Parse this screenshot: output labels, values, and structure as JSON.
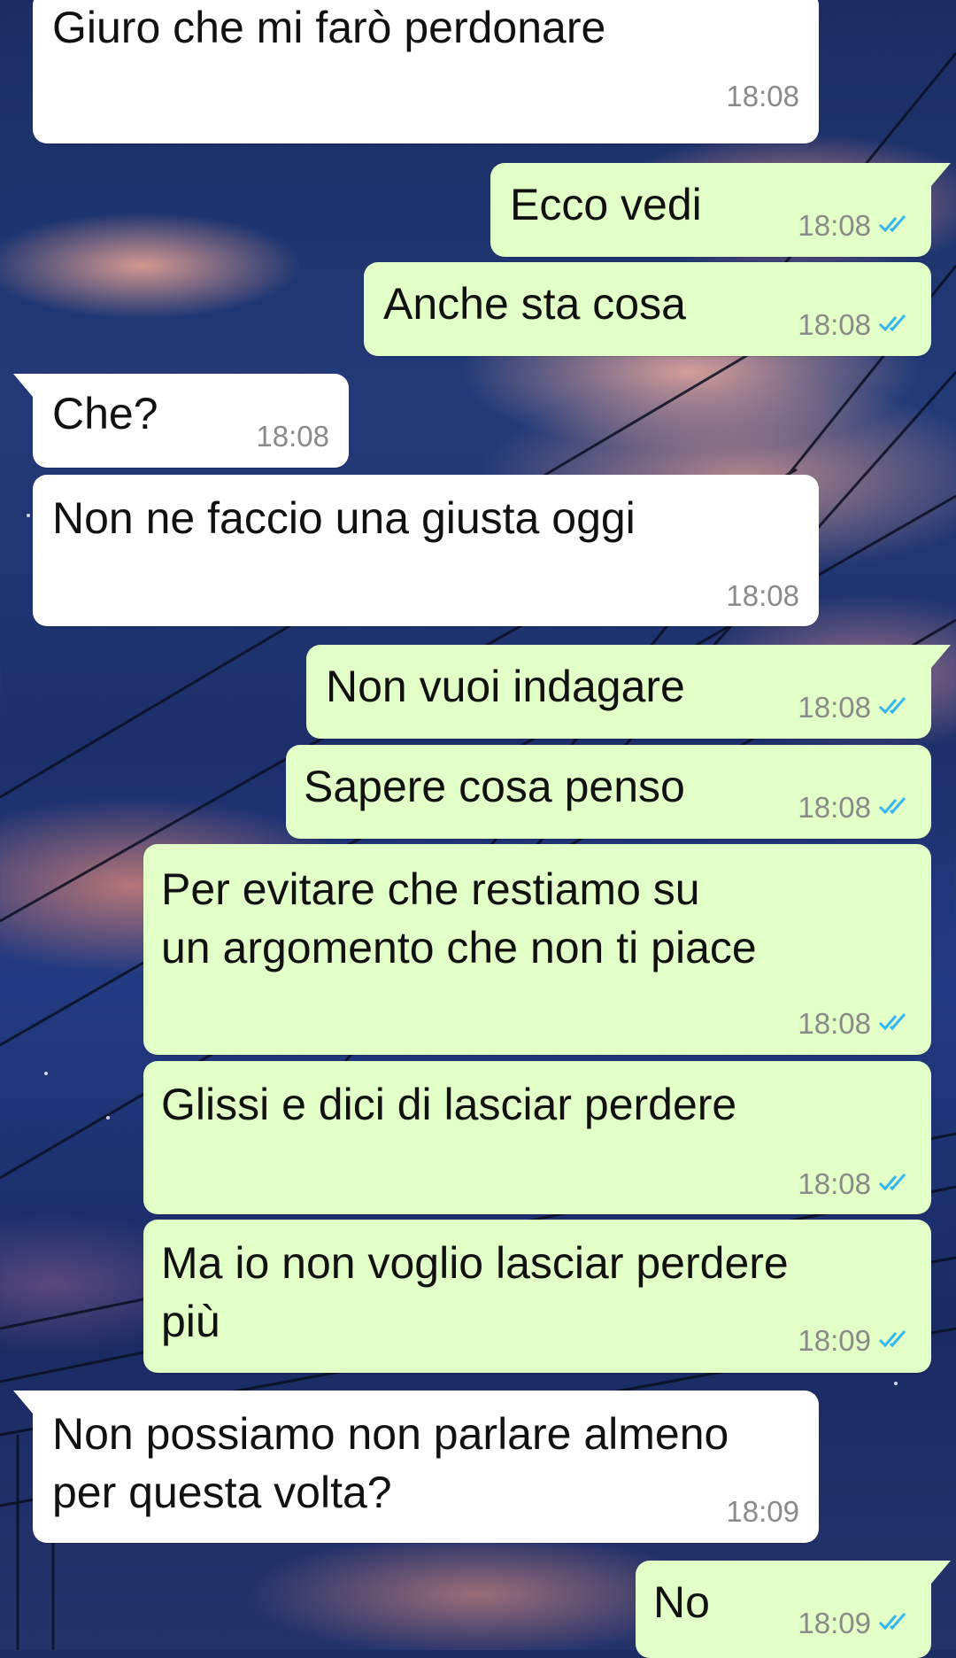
{
  "colors": {
    "incoming_bubble": "#ffffff",
    "outgoing_bubble": "#e2ffc7",
    "timestamp": "#8a8a8a",
    "read_check": "#34b7f1"
  },
  "messages": [
    {
      "direction": "in",
      "lines": [
        "Giuro che mi farò perdonare"
      ],
      "time": "18:08"
    },
    {
      "direction": "out",
      "lines": [
        "Ecco vedi"
      ],
      "time": "18:08",
      "status_icon": "double-check-read-icon"
    },
    {
      "direction": "out",
      "lines": [
        "Anche sta cosa"
      ],
      "time": "18:08",
      "status_icon": "double-check-read-icon"
    },
    {
      "direction": "in",
      "lines": [
        "Che?"
      ],
      "time": "18:08"
    },
    {
      "direction": "in",
      "lines": [
        "Non ne faccio una giusta oggi"
      ],
      "time": "18:08"
    },
    {
      "direction": "out",
      "lines": [
        "Non vuoi indagare"
      ],
      "time": "18:08",
      "status_icon": "double-check-read-icon"
    },
    {
      "direction": "out",
      "lines": [
        "Sapere cosa penso"
      ],
      "time": "18:08",
      "status_icon": "double-check-read-icon"
    },
    {
      "direction": "out",
      "lines": [
        "Per evitare che restiamo su",
        "un argomento che non ti piace"
      ],
      "time": "18:08",
      "status_icon": "double-check-read-icon"
    },
    {
      "direction": "out",
      "lines": [
        "Glissi e dici di lasciar perdere"
      ],
      "time": "18:08",
      "status_icon": "double-check-read-icon"
    },
    {
      "direction": "out",
      "lines": [
        "Ma io non voglio lasciar perdere",
        "più"
      ],
      "time": "18:09",
      "status_icon": "double-check-read-icon"
    },
    {
      "direction": "in",
      "lines": [
        "Non possiamo non parlare almeno",
        "per questa volta?"
      ],
      "time": "18:09"
    },
    {
      "direction": "out",
      "lines": [
        "No"
      ],
      "time": "18:09",
      "status_icon": "double-check-read-icon"
    }
  ]
}
